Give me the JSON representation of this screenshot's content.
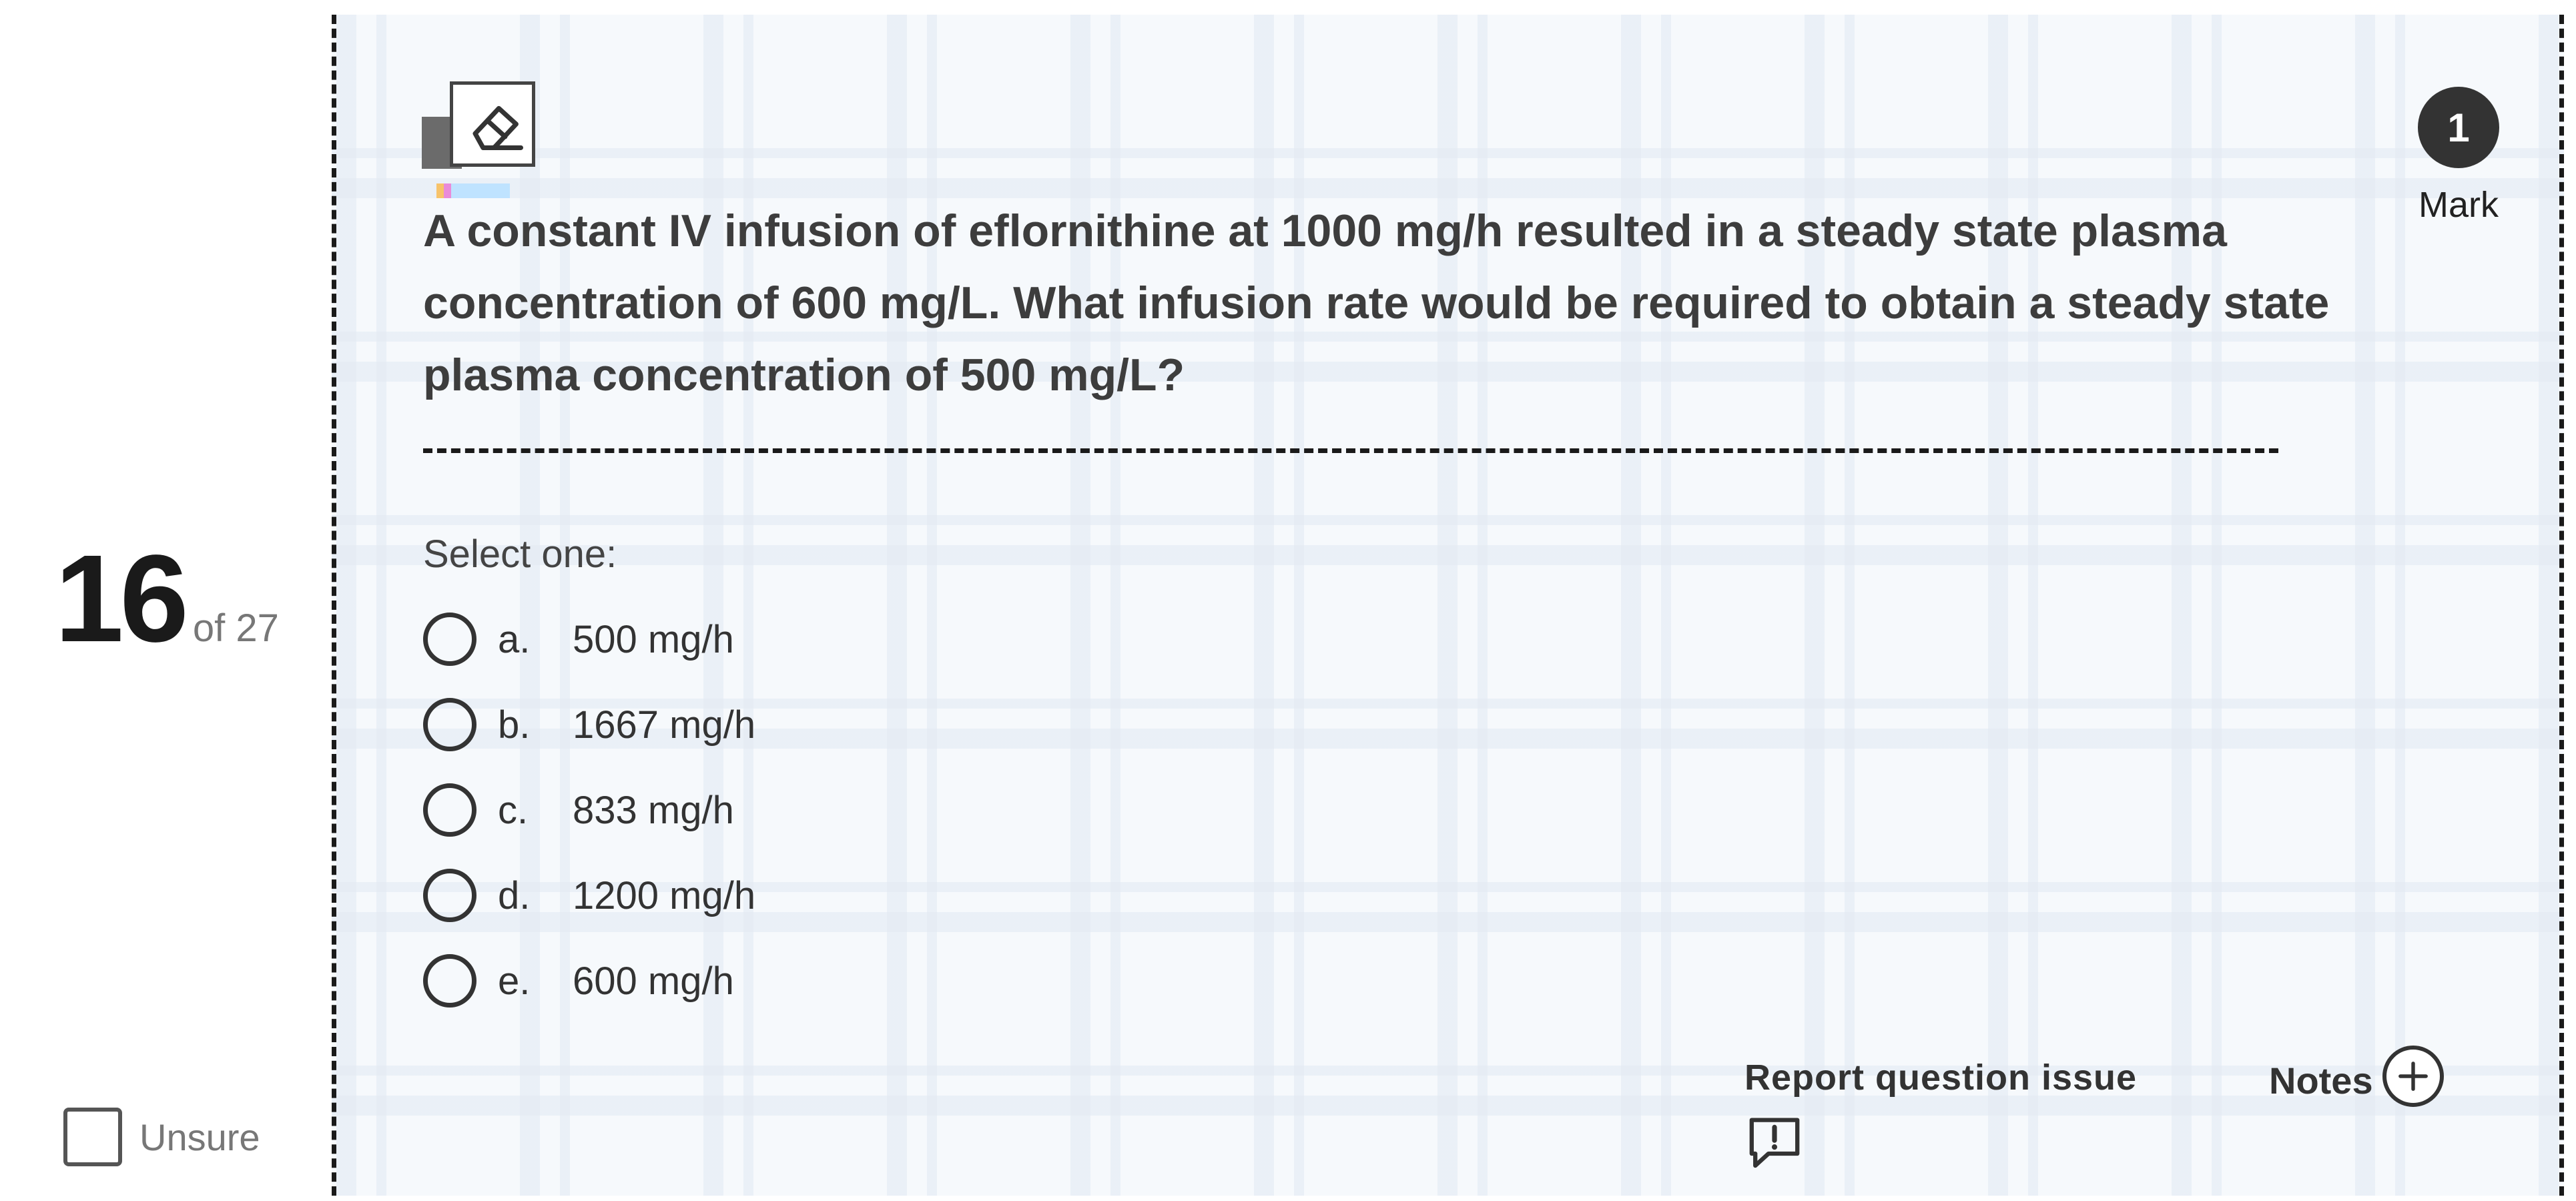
{
  "question_info": {
    "number": "16",
    "of_total": "of 27",
    "unsure_label": "Unsure"
  },
  "mark": {
    "value": "1",
    "label": "Mark"
  },
  "question": {
    "text": "A constant IV infusion of eflornithine at 1000 mg/h resulted in a steady state plasma concentration of 600 mg/L. What infusion rate would be required to obtain a steady state plasma concentration of 500 mg/L?"
  },
  "answer": {
    "prompt": "Select one:",
    "options": [
      {
        "letter": "a.",
        "text": "500 mg/h"
      },
      {
        "letter": "b.",
        "text": "1667 mg/h"
      },
      {
        "letter": "c.",
        "text": "833 mg/h"
      },
      {
        "letter": "d.",
        "text": "1200 mg/h"
      },
      {
        "letter": "e.",
        "text": "600 mg/h"
      }
    ]
  },
  "footer": {
    "report_label": "Report question issue",
    "notes_label": "Notes"
  },
  "icons": {
    "eraser": "eraser-icon",
    "report": "report-issue-icon",
    "notes_add": "plus-circle-icon"
  }
}
